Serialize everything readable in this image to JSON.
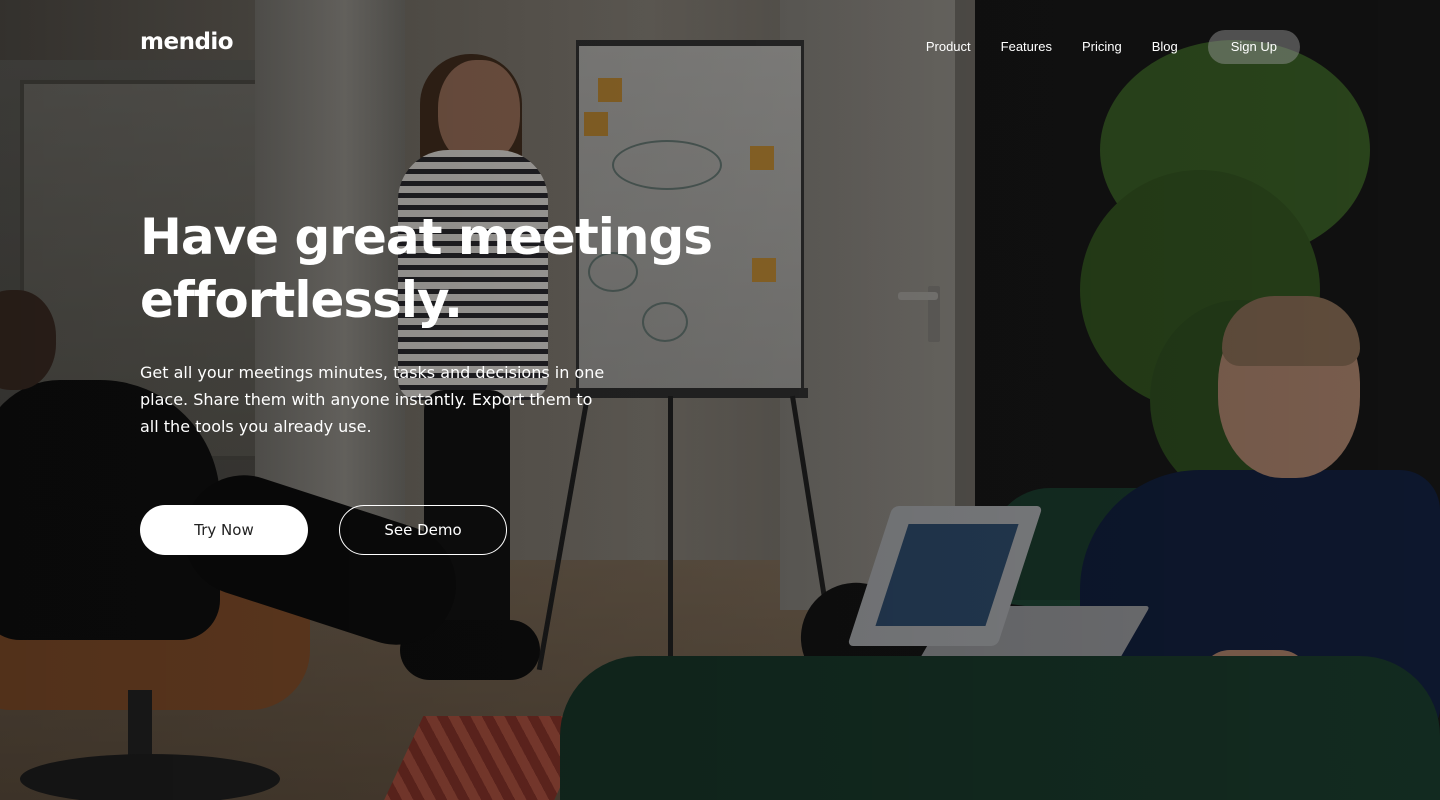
{
  "brand": {
    "logo_text": "mendio"
  },
  "nav": {
    "links": [
      {
        "label": "Product"
      },
      {
        "label": "Features"
      },
      {
        "label": "Pricing"
      },
      {
        "label": "Blog"
      }
    ],
    "signup_label": "Sign Up"
  },
  "hero": {
    "headline_line1": "Have great meetings",
    "headline_line2": "effortlessly.",
    "subtext": "Get all your meetings minutes, tasks and decisions in one place. Share them with anyone instantly. Export them to all the tools you already use.",
    "primary_cta": "Try Now",
    "secondary_cta": "See Demo",
    "background_image": "office-meeting-photo"
  },
  "colors": {
    "text": "#ffffff",
    "primary_button_bg": "#ffffff",
    "primary_button_text": "#222222",
    "signup_button_bg": "rgba(150,150,150,0.48)"
  }
}
